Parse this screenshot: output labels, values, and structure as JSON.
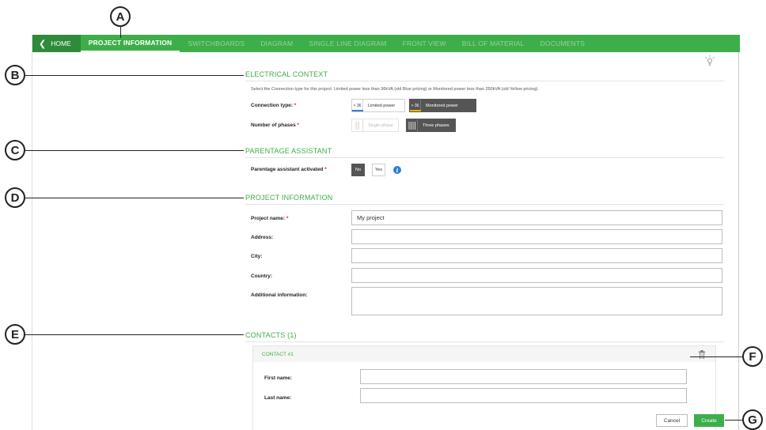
{
  "callouts": [
    "A",
    "B",
    "C",
    "D",
    "E",
    "F",
    "G"
  ],
  "nav": {
    "home_label": "HOME",
    "tabs": [
      "PROJECT INFORMATION",
      "SWITCHBOARDS",
      "DIAGRAM",
      "SINGLE LINE DIAGRAM",
      "FRONT VIEW",
      "BILL OF MATERIAL",
      "DOCUMENTS"
    ],
    "active_tab": "PROJECT INFORMATION"
  },
  "electrical": {
    "title": "ELECTRICAL CONTEXT",
    "description": "Select the Connection type for this project: Limited power less than 36kVA (old Blue pricing) or Monitored power less than 250kVA (old Yellow pricing).",
    "connection_label": "Connection type:",
    "connection_options": [
      {
        "icon_text": "< 36",
        "label": "Limited power",
        "selected": false
      },
      {
        "icon_text": "> 36",
        "label": "Monitored power",
        "selected": true
      }
    ],
    "phases_label": "Number of phases",
    "phase_options": [
      {
        "label": "Single phase",
        "selected": false
      },
      {
        "label": "Three phases",
        "selected": true
      }
    ],
    "required_mark": "*"
  },
  "parentage": {
    "title": "PARENTAGE ASSISTANT",
    "label": "Parentage assistant activated",
    "no_label": "No",
    "yes_label": "Yes",
    "info_glyph": "i"
  },
  "project": {
    "title": "PROJECT INFORMATION",
    "fields": [
      {
        "label": "Project name:",
        "value": "My project",
        "required": true
      },
      {
        "label": "Address:",
        "value": ""
      },
      {
        "label": "City:",
        "value": ""
      },
      {
        "label": "Country:",
        "value": ""
      },
      {
        "label": "Additional information:",
        "value": ""
      }
    ]
  },
  "contacts": {
    "title": "CONTACTS (1)",
    "contact_title": "CONTACT #1",
    "first_name_label": "First name:",
    "last_name_label": "Last name:",
    "first_name_value": "",
    "last_name_value": ""
  },
  "footer": {
    "cancel_label": "Cancel",
    "create_label": "Create"
  },
  "colors": {
    "brand_green": "#3dae49",
    "nav_dark_green": "#2e8b3a",
    "selected_gray": "#555555",
    "limited_power_blue": "#2a7fd4",
    "monitored_power_yellow": "#f0b400",
    "required_red": "#e02020"
  },
  "icons": [
    "chevron-left-icon",
    "lightbulb-icon",
    "info-icon",
    "trash-icon",
    "single-phase-icon",
    "three-phase-icon"
  ]
}
